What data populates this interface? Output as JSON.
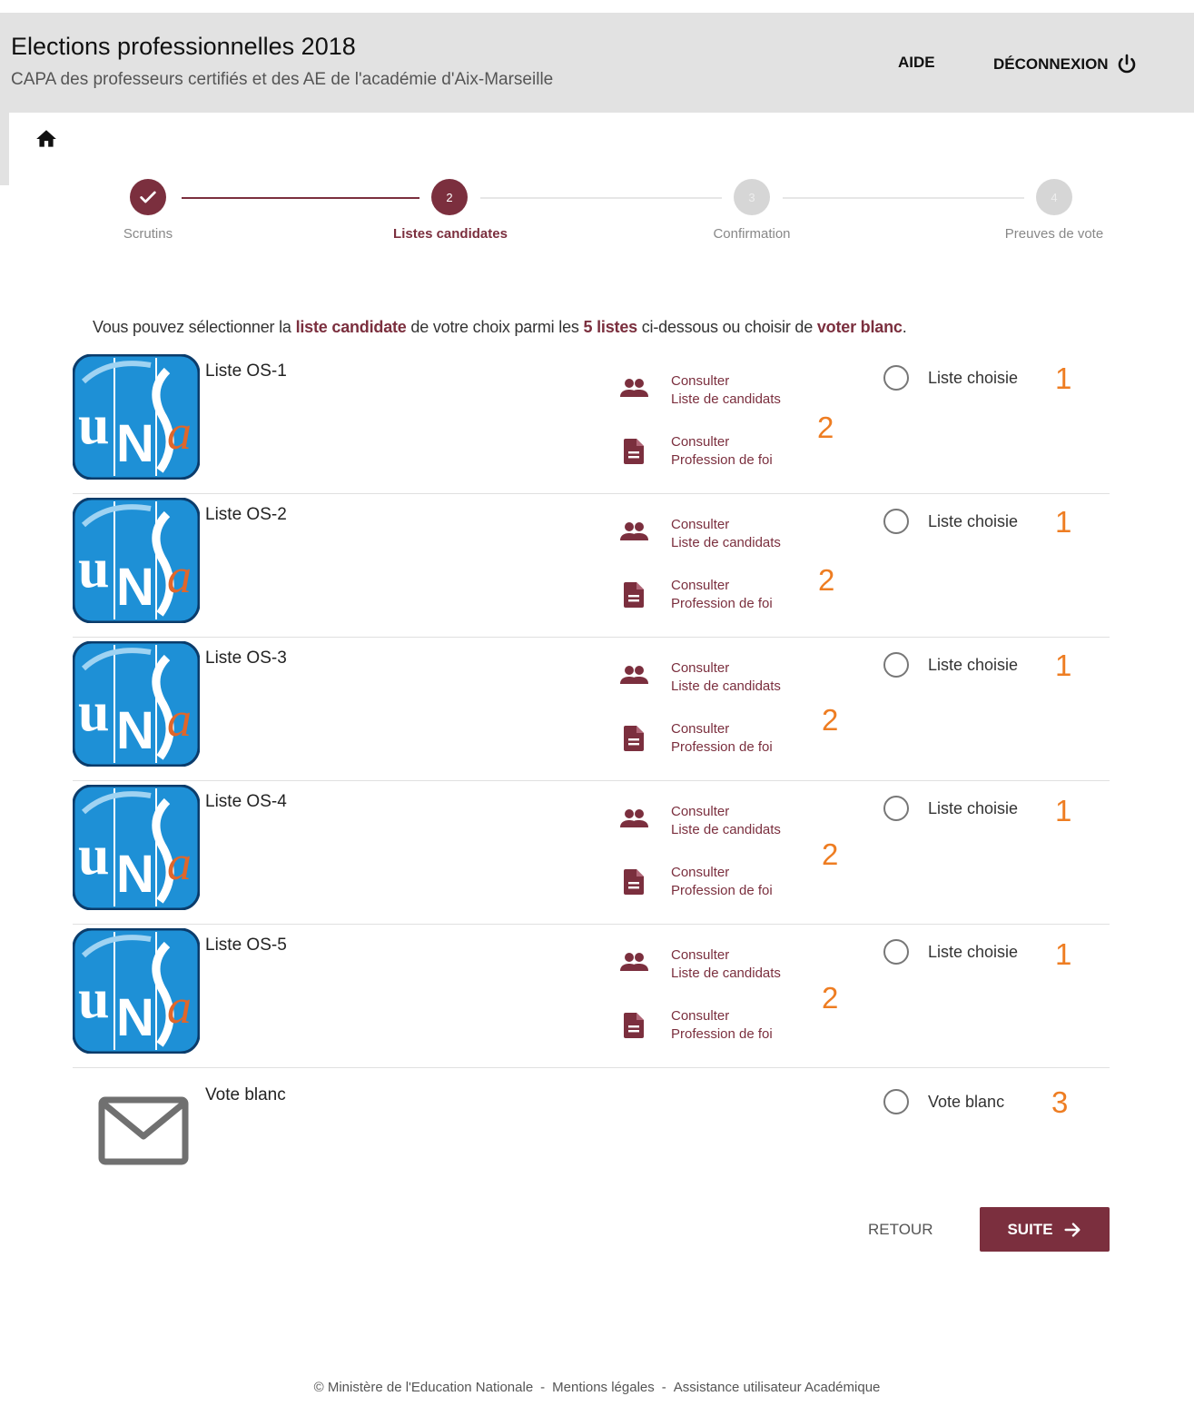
{
  "header": {
    "title": "Elections professionnelles 2018",
    "subtitle": "CAPA des professeurs certifiés et des AE de l'académie d'Aix-Marseille",
    "aide_label": "AIDE",
    "logout_label": "DÉCONNEXION"
  },
  "stepper": {
    "steps": [
      {
        "label": "Scrutins",
        "number": "",
        "state": "done"
      },
      {
        "label": "Listes candidates",
        "number": "2",
        "state": "active"
      },
      {
        "label": "Confirmation",
        "number": "3",
        "state": "todo"
      },
      {
        "label": "Preuves de vote",
        "number": "4",
        "state": "todo"
      }
    ]
  },
  "intro": {
    "p1": "Vous pouvez sélectionner la ",
    "b1": "liste candidate",
    "p2": " de votre choix parmi les ",
    "b2": "5 listes",
    "p3": " ci-dessous ou choisir de ",
    "b3": "voter blanc",
    "p4": "."
  },
  "lists": [
    {
      "name": "Liste OS-1",
      "link1_a": "Consulter",
      "link1_b": "Liste de candidats",
      "link2_a": "Consulter",
      "link2_b": "Profession de foi",
      "radio_label": "Liste choisie",
      "ann1": "1",
      "ann2": "2"
    },
    {
      "name": "Liste OS-2",
      "link1_a": "Consulter",
      "link1_b": "Liste de candidats",
      "link2_a": "Consulter",
      "link2_b": "Profession de foi",
      "radio_label": "Liste choisie",
      "ann1": "1",
      "ann2": "2"
    },
    {
      "name": "Liste OS-3",
      "link1_a": "Consulter",
      "link1_b": "Liste de candidats",
      "link2_a": "Consulter",
      "link2_b": "Profession de foi",
      "radio_label": "Liste choisie",
      "ann1": "1",
      "ann2": "2"
    },
    {
      "name": "Liste OS-4",
      "link1_a": "Consulter",
      "link1_b": "Liste de candidats",
      "link2_a": "Consulter",
      "link2_b": "Profession de foi",
      "radio_label": "Liste choisie",
      "ann1": "1",
      "ann2": "2"
    },
    {
      "name": "Liste OS-5",
      "link1_a": "Consulter",
      "link1_b": "Liste de candidats",
      "link2_a": "Consulter",
      "link2_b": "Profession de foi",
      "radio_label": "Liste choisie",
      "ann1": "1",
      "ann2": "2"
    }
  ],
  "blank": {
    "name": "Vote blanc",
    "radio_label": "Vote blanc",
    "ann": "3"
  },
  "logo_text": {
    "u": "u",
    "n": "N",
    "a": "a"
  },
  "actions": {
    "back_label": "RETOUR",
    "next_label": "SUITE"
  },
  "footer": {
    "copyright": "© Ministère de l'Education Nationale",
    "sep": "-",
    "legal": "Mentions légales",
    "support": "Assistance utilisateur Académique"
  },
  "colors": {
    "brand": "#7b2f3e",
    "annotation": "#ee7d22",
    "logo_blue": "#1e90d6"
  }
}
